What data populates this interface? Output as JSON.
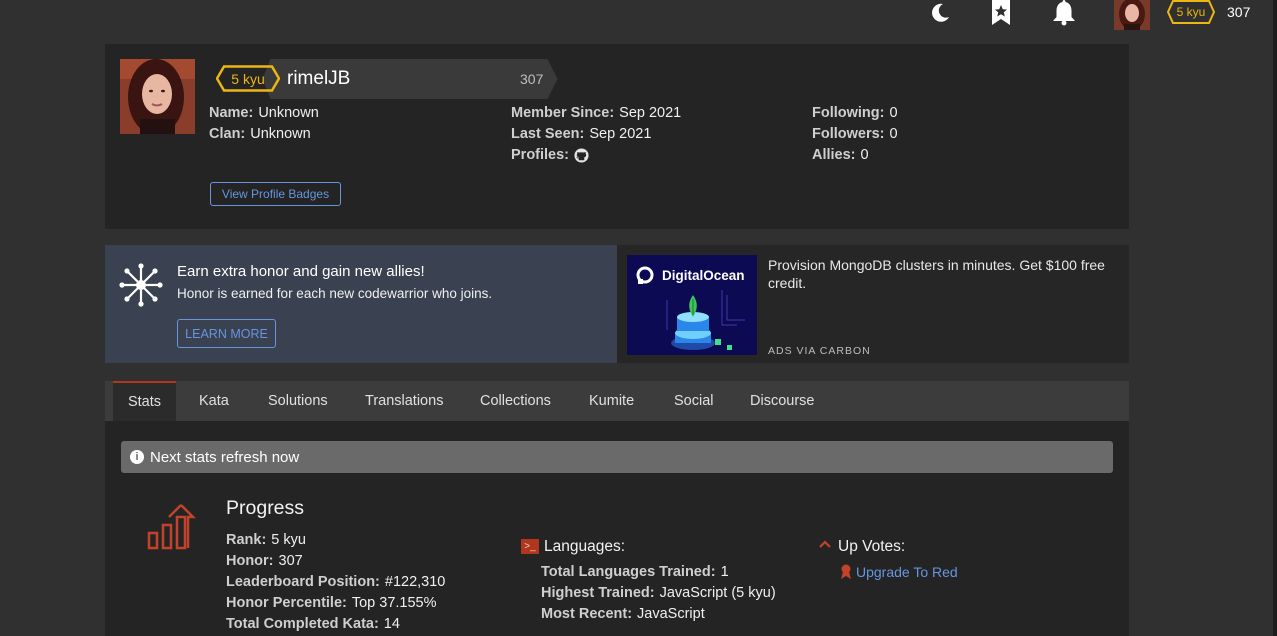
{
  "topnav": {
    "icons": [
      "moon-icon",
      "bookmark-star-icon",
      "bell-icon"
    ],
    "rank": "5 kyu",
    "honor": "307"
  },
  "profile": {
    "rank": "5 kyu",
    "username": "rimelJB",
    "honor": "307",
    "name_label": "Name:",
    "name_value": "Unknown",
    "clan_label": "Clan:",
    "clan_value": "Unknown",
    "member_since_label": "Member Since:",
    "member_since_value": "Sep 2021",
    "last_seen_label": "Last Seen:",
    "last_seen_value": "Sep 2021",
    "profiles_label": "Profiles:",
    "following_label": "Following:",
    "following_value": "0",
    "followers_label": "Followers:",
    "followers_value": "0",
    "allies_label": "Allies:",
    "allies_value": "0",
    "badges_button": "View Profile Badges"
  },
  "promo": {
    "title": "Earn extra honor and gain new allies!",
    "subtitle": "Honor is earned for each new codewarrior who joins.",
    "button": "LEARN MORE"
  },
  "ad": {
    "brand": "DigitalOcean",
    "text": "Provision MongoDB clusters in minutes. Get $100 free credit.",
    "via": "ADS VIA CARBON"
  },
  "tabs": [
    "Stats",
    "Kata",
    "Solutions",
    "Translations",
    "Collections",
    "Kumite",
    "Social",
    "Discourse"
  ],
  "active_tab": "Stats",
  "alert": {
    "text": "Next stats refresh now"
  },
  "progress": {
    "title": "Progress",
    "rank_label": "Rank:",
    "rank_value": "5 kyu",
    "honor_label": "Honor:",
    "honor_value": "307",
    "leaderboard_label": "Leaderboard Position:",
    "leaderboard_value": "#122,310",
    "percentile_label": "Honor Percentile:",
    "percentile_value": "Top 37.155%",
    "completed_label": "Total Completed Kata:",
    "completed_value": "14"
  },
  "languages": {
    "title": "Languages:",
    "trained_label": "Total Languages Trained:",
    "trained_value": "1",
    "highest_label": "Highest Trained:",
    "highest_value": "JavaScript (5 kyu)",
    "recent_label": "Most Recent:",
    "recent_value": "JavaScript"
  },
  "upvotes": {
    "title": "Up Votes:",
    "link": "Upgrade To Red"
  },
  "colors": {
    "background": "#303030",
    "card": "#242424",
    "accent_red": "#b1361e",
    "kyu_yellow": "#ecb613",
    "link_blue": "#6795de"
  }
}
